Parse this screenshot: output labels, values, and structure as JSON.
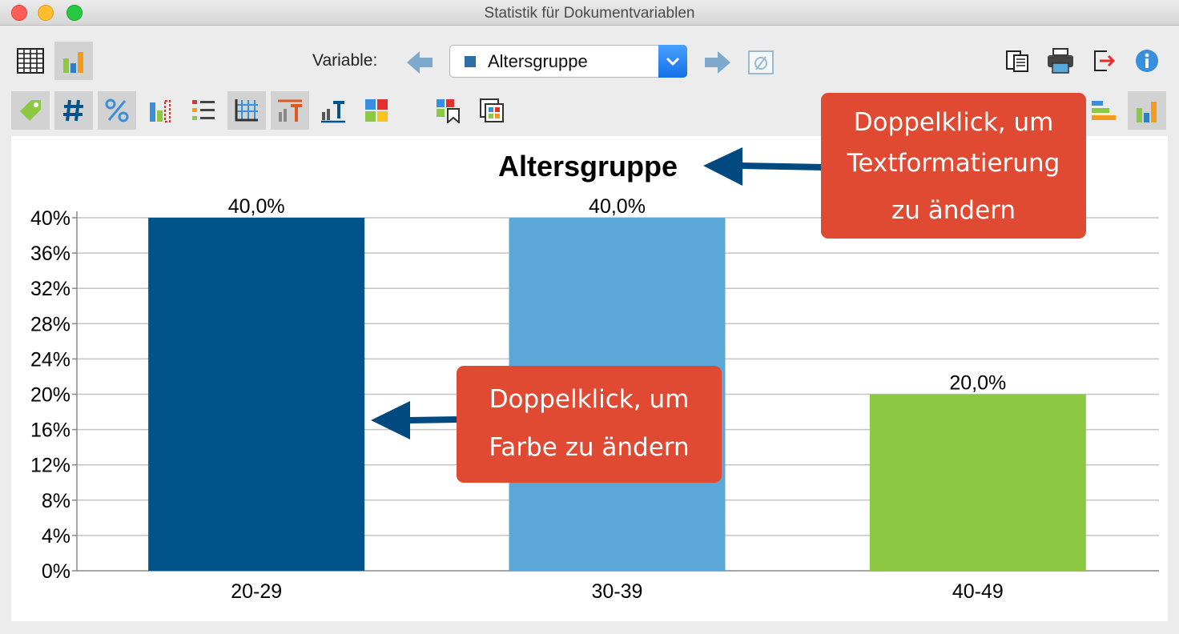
{
  "window": {
    "title": "Statistik für Dokumentvariablen"
  },
  "toolbar": {
    "variable_label": "Variable:",
    "selected_variable": "Altersgruppe",
    "view_table": "table-view-icon",
    "view_chart": "bar-chart-view-icon"
  },
  "colors": {
    "bar1": "#00548a",
    "bar2": "#5aa7d8",
    "bar3": "#8dc842",
    "callout": "#e04a32",
    "arrow": "#004a80"
  },
  "callouts": {
    "title_hint": [
      "Doppelklick, um",
      "Textformatierung",
      "zu ändern"
    ],
    "color_hint": [
      "Doppelklick, um",
      "Farbe zu ändern"
    ]
  },
  "chart_data": {
    "type": "bar",
    "title": "Altersgruppe",
    "categories": [
      "20-29",
      "30-39",
      "40-49"
    ],
    "values": [
      40,
      40,
      20
    ],
    "data_labels": [
      "40,0%",
      "40,0%",
      "20,0%"
    ],
    "yticks": [
      "0%",
      "4%",
      "8%",
      "12%",
      "16%",
      "20%",
      "24%",
      "28%",
      "32%",
      "36%",
      "40%"
    ],
    "ylim": [
      0,
      40
    ],
    "grid": true,
    "legend": "none"
  }
}
